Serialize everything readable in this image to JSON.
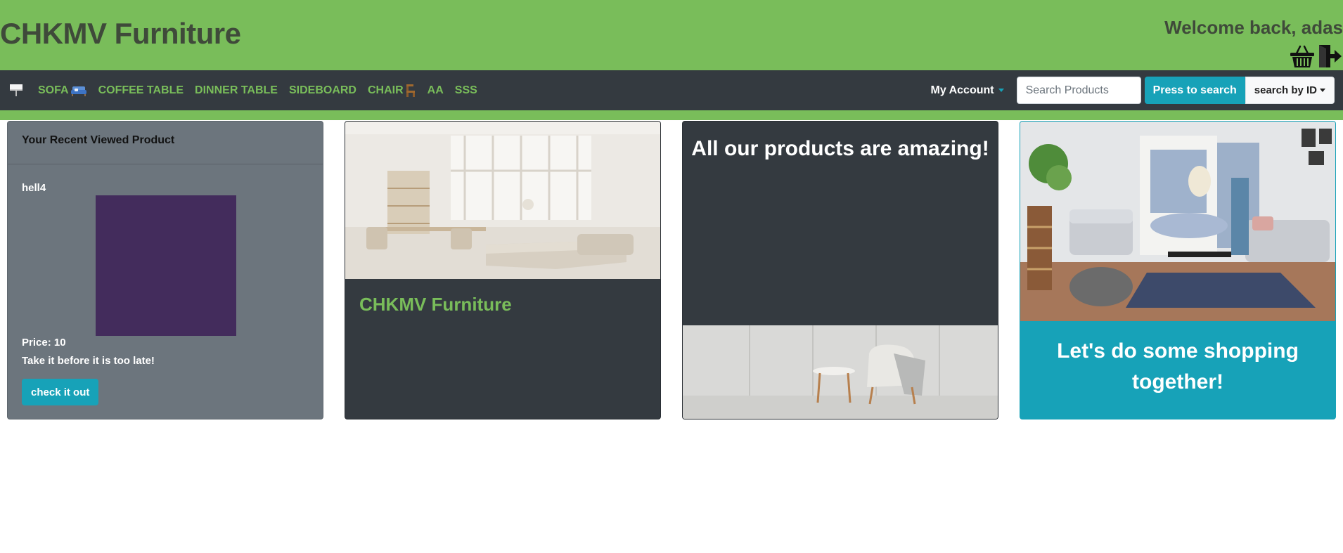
{
  "header": {
    "brand": "CHKMV Furniture",
    "welcome": "Welcome back, adas",
    "icons": [
      "basket-icon",
      "logout-icon"
    ]
  },
  "nav": {
    "flag_icon": "flag-icon",
    "items": [
      {
        "label": "SOFA",
        "icon": "sofa-icon"
      },
      {
        "label": "COFFEE TABLE"
      },
      {
        "label": "DINNER TABLE"
      },
      {
        "label": "SIDEBOARD"
      },
      {
        "label": "CHAIR",
        "icon": "chair-icon"
      },
      {
        "label": "AA"
      },
      {
        "label": "SSS"
      }
    ],
    "account": "My Account",
    "search_placeholder": "Search Products",
    "search_button": "Press to search",
    "search_mode": "search by ID"
  },
  "cards": {
    "recent": {
      "heading": "Your Recent Viewed Product",
      "product_name": "hell4",
      "swatch_color": "#432c5c",
      "price": "Price: 10",
      "tagline": "Take it before it is too late!",
      "button": "check it out"
    },
    "brand_card": {
      "title": "CHKMV Furniture"
    },
    "amazing": {
      "title": "All our products are amazing!"
    },
    "shopping": {
      "title": "Let's do some shopping together!"
    }
  },
  "colors": {
    "green": "#79bd5a",
    "dark": "#343a40",
    "gray": "#6c757d",
    "teal": "#17a2b8"
  }
}
